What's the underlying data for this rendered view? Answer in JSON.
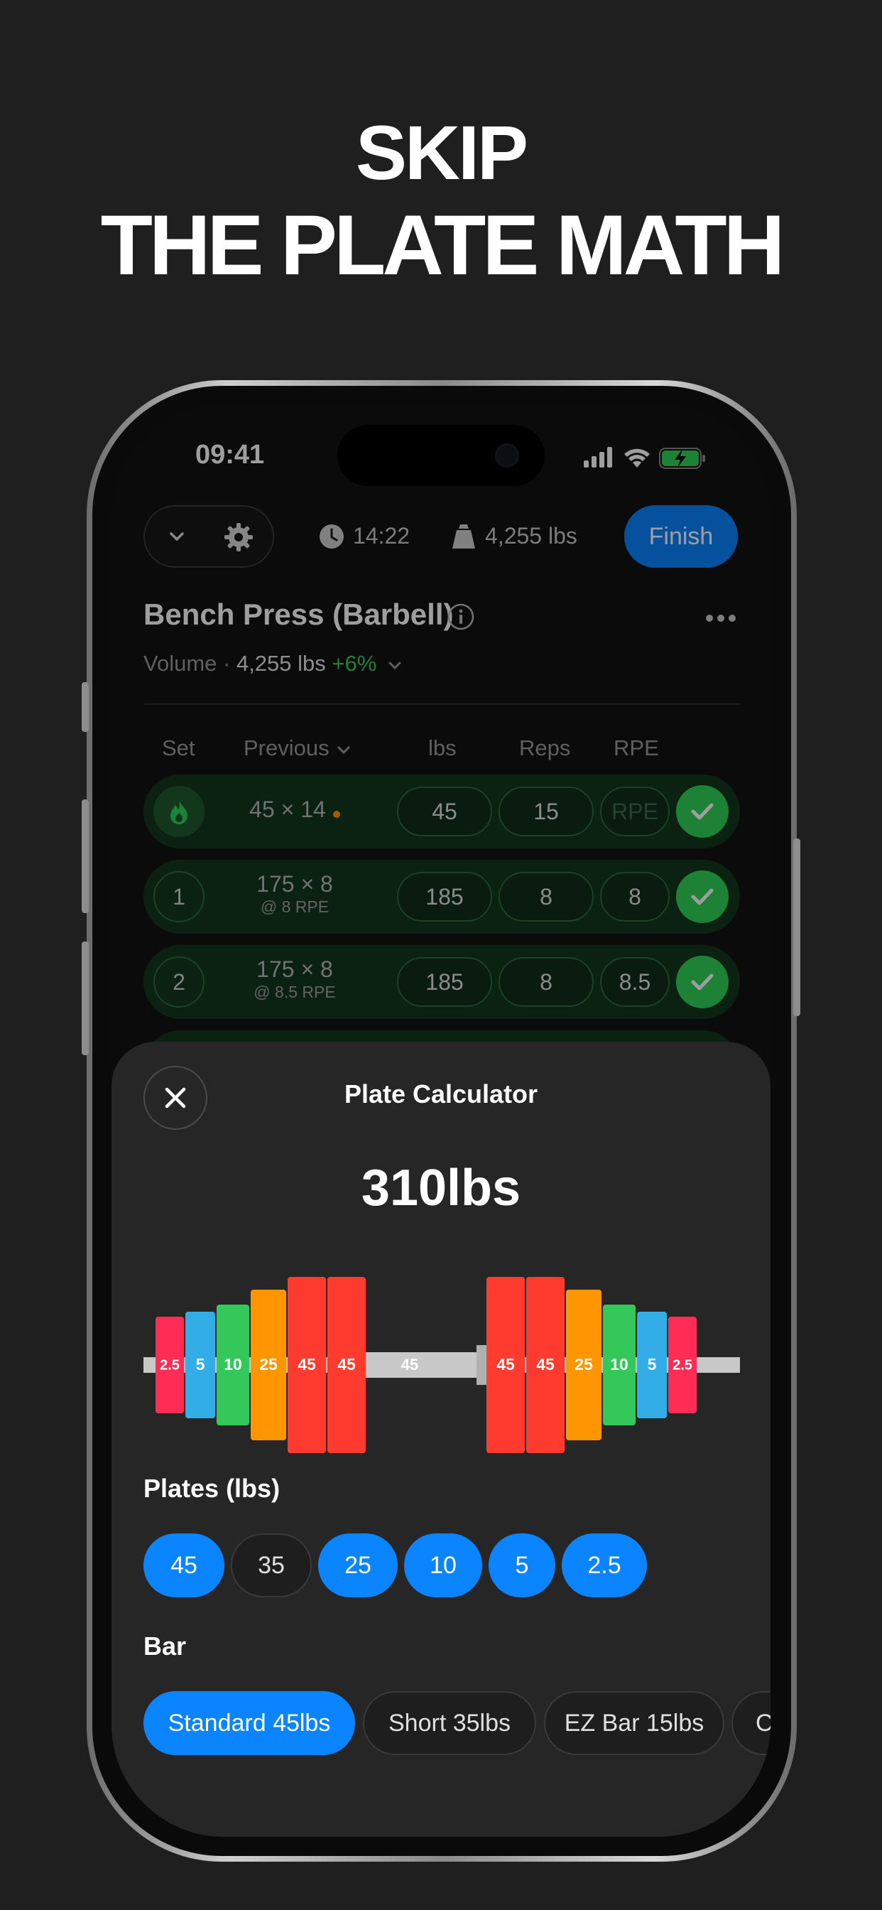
{
  "headline": {
    "line1": "SKIP",
    "line2": "THE PLATE MATH"
  },
  "status_bar": {
    "time": "09:41",
    "icons": [
      "signal-icon",
      "wifi-icon",
      "battery-charging-icon"
    ]
  },
  "workout_bar": {
    "timer": "14:22",
    "volume": "4,255 lbs",
    "finish_label": "Finish"
  },
  "exercise": {
    "title": "Bench Press (Barbell)",
    "volume_prefix": "Volume · ",
    "volume_value": "4,255 lbs",
    "volume_change": "+6%"
  },
  "table": {
    "headers": {
      "set": "Set",
      "previous": "Previous",
      "lbs": "lbs",
      "reps": "Reps",
      "rpe": "RPE"
    },
    "rows": [
      {
        "set": "",
        "warmup": true,
        "previous": "45 × 14",
        "previous_sub": "",
        "lbs": "45",
        "reps": "15",
        "rpe": "RPE",
        "done": true
      },
      {
        "set": "1",
        "warmup": false,
        "previous": "175 × 8",
        "previous_sub": "@ 8 RPE",
        "lbs": "185",
        "reps": "8",
        "rpe": "8",
        "done": true
      },
      {
        "set": "2",
        "warmup": false,
        "previous": "175 × 8",
        "previous_sub": "@ 8.5 RPE",
        "lbs": "185",
        "reps": "8",
        "rpe": "8.5",
        "done": true
      }
    ]
  },
  "plate_calculator": {
    "title": "Plate Calculator",
    "total": "310lbs",
    "bar_label": "45",
    "left_plates": [
      "2.5",
      "5",
      "10",
      "25",
      "45",
      "45"
    ],
    "right_plates": [
      "45",
      "45",
      "25",
      "10",
      "5",
      "2.5"
    ],
    "plate_colors": {
      "45": "#ff3b30",
      "25": "#ff9500",
      "10": "#34c759",
      "5": "#32ade6",
      "2.5": "#ff2d55"
    },
    "plates_label": "Plates (lbs)",
    "plates": [
      {
        "label": "45",
        "selected": true
      },
      {
        "label": "35",
        "selected": false
      },
      {
        "label": "25",
        "selected": true
      },
      {
        "label": "10",
        "selected": true
      },
      {
        "label": "5",
        "selected": true
      },
      {
        "label": "2.5",
        "selected": true
      }
    ],
    "bar_section_label": "Bar",
    "bars": [
      {
        "label": "Standard 45lbs",
        "selected": true
      },
      {
        "label": "Short 35lbs",
        "selected": false
      },
      {
        "label": "EZ Bar 15lbs",
        "selected": false
      },
      {
        "label": "C",
        "selected": false
      }
    ]
  },
  "colors": {
    "accent": "#0a84ff",
    "success": "#30d158",
    "background": "#1f1f1f"
  }
}
